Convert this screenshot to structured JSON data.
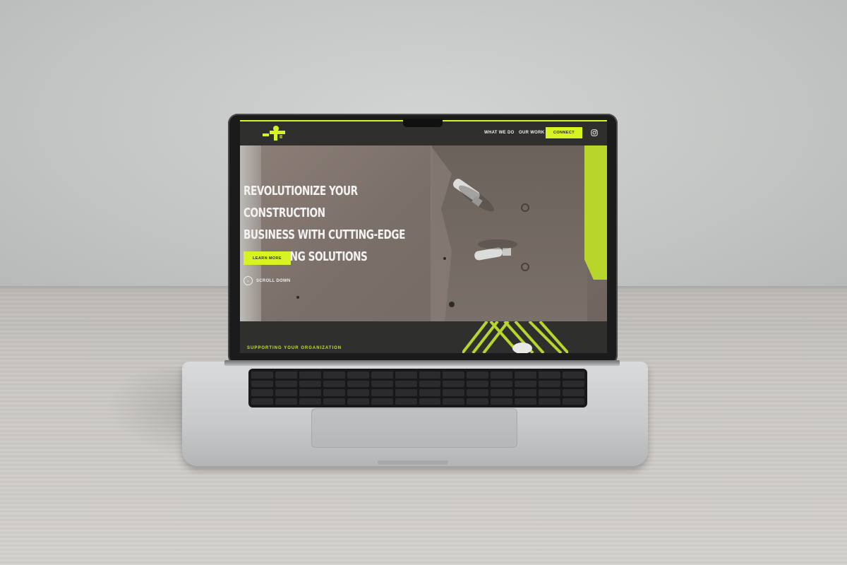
{
  "nav": {
    "links": [
      "WHAT WE DO",
      "OUR WORK"
    ],
    "cta": "CONNECT",
    "social_icon": "instagram-icon"
  },
  "hero": {
    "headline_lines": [
      "REVOLUTIONIZE YOUR CONSTRUCTION",
      "BUSINESS WITH CUTTING-EDGE",
      "MARKETING SOLUTIONS"
    ],
    "button": "LEARN MORE",
    "scroll": "SCROLL DOWN"
  },
  "section": {
    "label": "SUPPORTING YOUR ORGANIZATION"
  },
  "colors": {
    "accent": "#d7f422",
    "nav_bg": "#2f302d"
  }
}
